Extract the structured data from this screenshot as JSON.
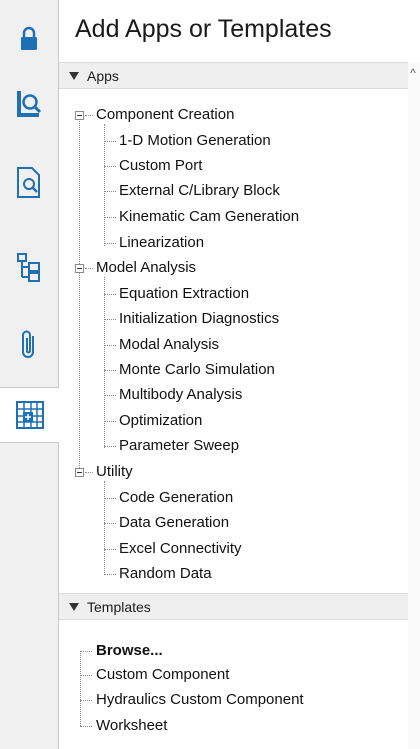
{
  "panel": {
    "title": "Add Apps or Templates"
  },
  "toolbar": {
    "items": [
      {
        "icon": "lock-icon"
      },
      {
        "icon": "palette-search-icon"
      },
      {
        "icon": "document-search-icon"
      },
      {
        "icon": "hierarchy-icon"
      },
      {
        "icon": "paperclip-icon"
      },
      {
        "icon": "add-apps-grid-icon",
        "active": true
      }
    ]
  },
  "apps_section": {
    "label": "Apps",
    "groups": [
      {
        "label": "Component Creation",
        "items": [
          "1-D Motion Generation",
          "Custom Port",
          "External C/Library Block",
          "Kinematic Cam Generation",
          "Linearization"
        ]
      },
      {
        "label": "Model Analysis",
        "items": [
          "Equation Extraction",
          "Initialization Diagnostics",
          "Modal Analysis",
          "Monte Carlo Simulation",
          "Multibody Analysis",
          "Optimization",
          "Parameter Sweep"
        ]
      },
      {
        "label": "Utility",
        "items": [
          "Code Generation",
          "Data Generation",
          "Excel Connectivity",
          "Random Data"
        ]
      }
    ]
  },
  "templates_section": {
    "label": "Templates",
    "items": [
      "Browse...",
      "Custom Component",
      "Hydraulics Custom Component",
      "Worksheet"
    ]
  },
  "colors": {
    "accent_blue": "#1f6fb5",
    "header_bg": "#efefef"
  }
}
